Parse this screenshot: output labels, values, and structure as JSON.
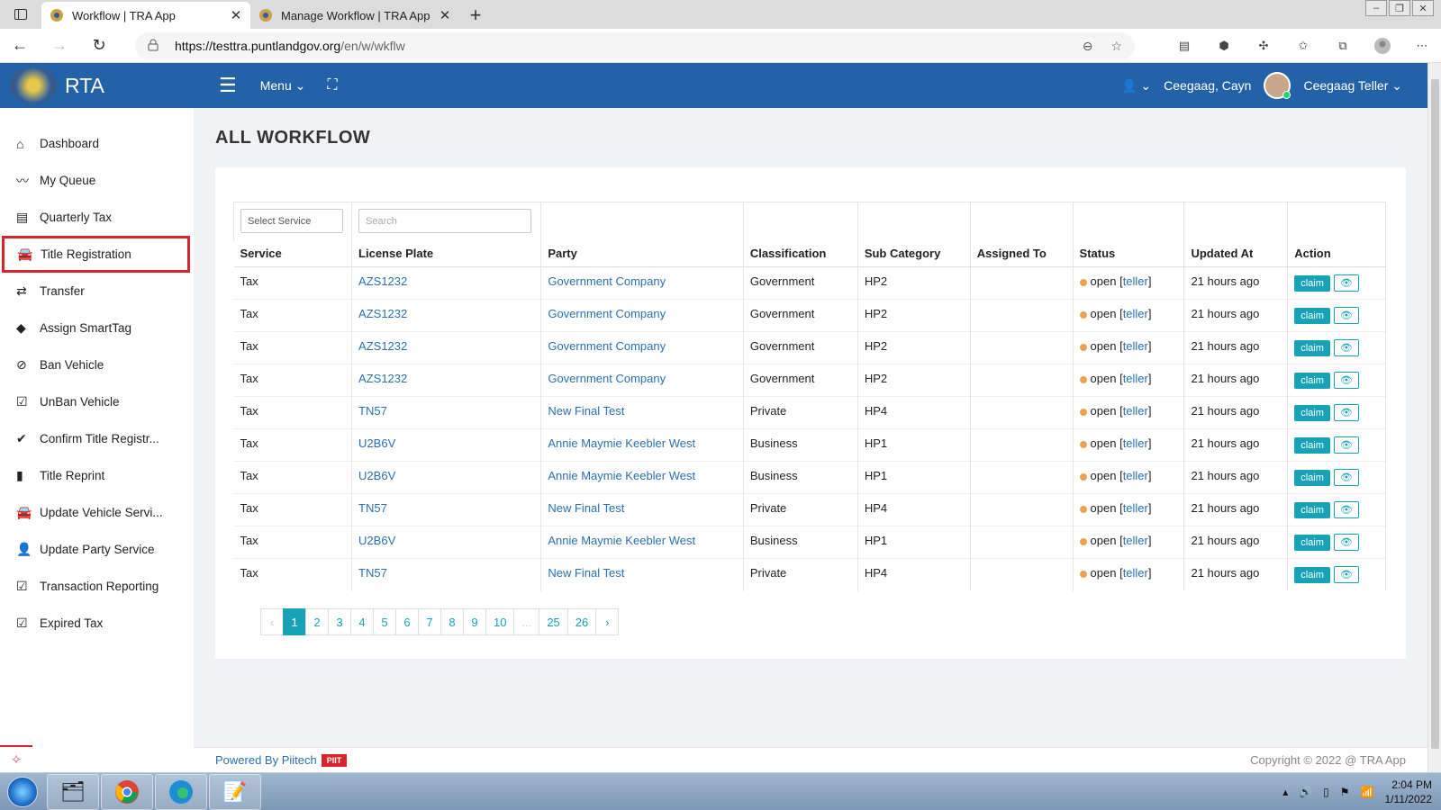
{
  "browser": {
    "tabs": [
      {
        "title": "Workflow | TRA App",
        "active": true
      },
      {
        "title": "Manage Workflow | TRA App",
        "active": false
      }
    ],
    "url_host": "https://testtra.puntlandgov.org",
    "url_path": "/en/w/wkflw"
  },
  "app": {
    "brand": "RTA",
    "menu_label": "Menu",
    "user_org": "Ceegaag, Cayn",
    "user_name": "Ceegaag Teller"
  },
  "sidebar": {
    "items": [
      {
        "label": "Dashboard",
        "icon": "home-icon"
      },
      {
        "label": "My Queue",
        "icon": "line-chart-icon"
      },
      {
        "label": "Quarterly Tax",
        "icon": "list-icon"
      },
      {
        "label": "Title Registration",
        "icon": "car-icon",
        "highlighted": true
      },
      {
        "label": "Transfer",
        "icon": "exchange-icon"
      },
      {
        "label": "Assign SmartTag",
        "icon": "tags-icon"
      },
      {
        "label": "Ban Vehicle",
        "icon": "ban-icon"
      },
      {
        "label": "UnBan Vehicle",
        "icon": "check-square-icon"
      },
      {
        "label": "Confirm Title Registr...",
        "icon": "check-icon"
      },
      {
        "label": "Title Reprint",
        "icon": "file-icon"
      },
      {
        "label": "Update Vehicle Servi...",
        "icon": "car-icon"
      },
      {
        "label": "Update Party Service",
        "icon": "user-icon"
      },
      {
        "label": "Transaction Reporting",
        "icon": "check-square-icon"
      },
      {
        "label": "Expired Tax",
        "icon": "check-square-icon"
      }
    ]
  },
  "page": {
    "title": "ALL WORKFLOW",
    "filters": {
      "service_placeholder": "Select Service",
      "search_placeholder": "Search"
    },
    "columns": [
      "Service",
      "License Plate",
      "Party",
      "Classification",
      "Sub Category",
      "Assigned To",
      "Status",
      "Updated At",
      "Action"
    ],
    "rows": [
      {
        "service": "Tax",
        "plate": "AZS1232",
        "party": "Government Company",
        "classification": "Government",
        "sub": "HP2",
        "assigned": "",
        "status": "open",
        "role": "teller",
        "updated": "21 hours ago"
      },
      {
        "service": "Tax",
        "plate": "AZS1232",
        "party": "Government Company",
        "classification": "Government",
        "sub": "HP2",
        "assigned": "",
        "status": "open",
        "role": "teller",
        "updated": "21 hours ago"
      },
      {
        "service": "Tax",
        "plate": "AZS1232",
        "party": "Government Company",
        "classification": "Government",
        "sub": "HP2",
        "assigned": "",
        "status": "open",
        "role": "teller",
        "updated": "21 hours ago"
      },
      {
        "service": "Tax",
        "plate": "AZS1232",
        "party": "Government Company",
        "classification": "Government",
        "sub": "HP2",
        "assigned": "",
        "status": "open",
        "role": "teller",
        "updated": "21 hours ago"
      },
      {
        "service": "Tax",
        "plate": "TN57",
        "party": "New Final Test",
        "classification": "Private",
        "sub": "HP4",
        "assigned": "",
        "status": "open",
        "role": "teller",
        "updated": "21 hours ago"
      },
      {
        "service": "Tax",
        "plate": "U2B6V",
        "party": "Annie Maymie Keebler West",
        "classification": "Business",
        "sub": "HP1",
        "assigned": "",
        "status": "open",
        "role": "teller",
        "updated": "21 hours ago"
      },
      {
        "service": "Tax",
        "plate": "U2B6V",
        "party": "Annie Maymie Keebler West",
        "classification": "Business",
        "sub": "HP1",
        "assigned": "",
        "status": "open",
        "role": "teller",
        "updated": "21 hours ago"
      },
      {
        "service": "Tax",
        "plate": "TN57",
        "party": "New Final Test",
        "classification": "Private",
        "sub": "HP4",
        "assigned": "",
        "status": "open",
        "role": "teller",
        "updated": "21 hours ago"
      },
      {
        "service": "Tax",
        "plate": "U2B6V",
        "party": "Annie Maymie Keebler West",
        "classification": "Business",
        "sub": "HP1",
        "assigned": "",
        "status": "open",
        "role": "teller",
        "updated": "21 hours ago"
      },
      {
        "service": "Tax",
        "plate": "TN57",
        "party": "New Final Test",
        "classification": "Private",
        "sub": "HP4",
        "assigned": "",
        "status": "open",
        "role": "teller",
        "updated": "21 hours ago"
      }
    ],
    "claim_label": "claim",
    "pagination": [
      "‹",
      "1",
      "2",
      "3",
      "4",
      "5",
      "6",
      "7",
      "8",
      "9",
      "10",
      "...",
      "25",
      "26",
      "›"
    ],
    "current_page": "1"
  },
  "footer": {
    "powered": "Powered By Piitech",
    "badge": "PIIT",
    "copyright": "Copyright © 2022 @ TRA App"
  },
  "taskbar": {
    "time": "2:04 PM",
    "date": "1/11/2022"
  },
  "colors": {
    "header_blue": "#2462a8",
    "accent_teal": "#17a2b8",
    "highlight_red": "#d9232d",
    "status_open": "#f0a050"
  }
}
